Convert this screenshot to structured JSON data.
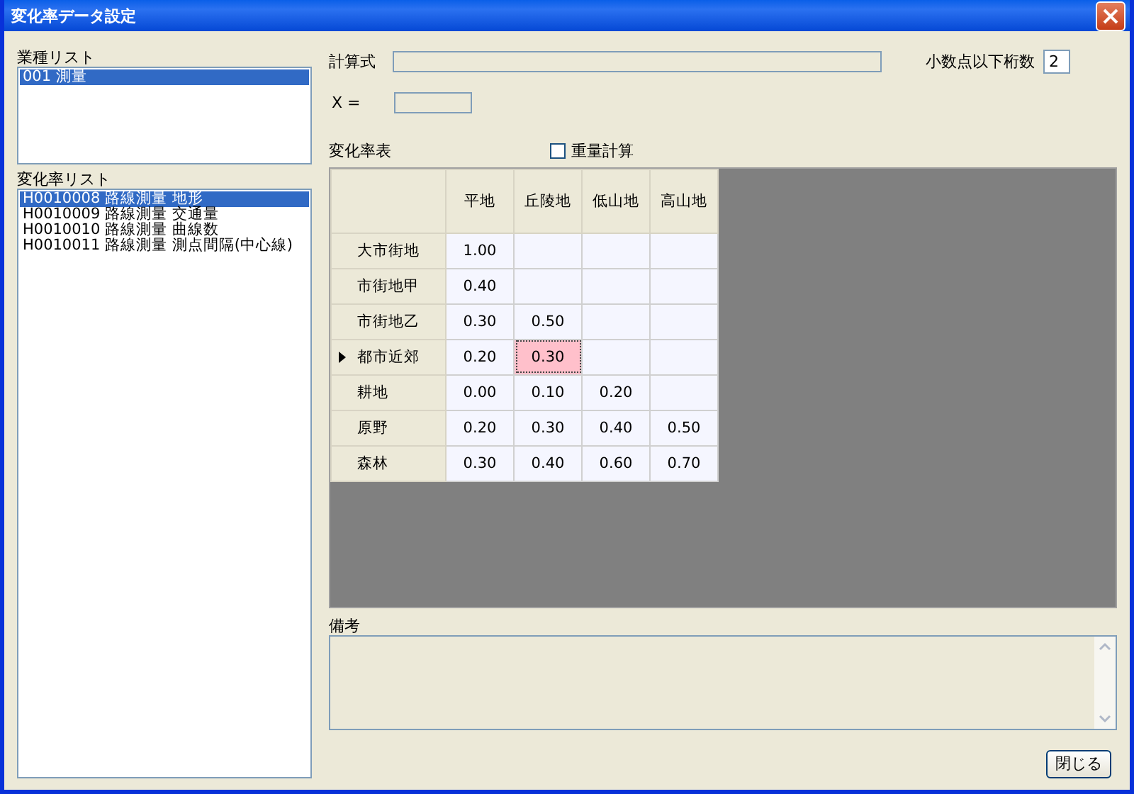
{
  "window": {
    "title": "変化率データ設定"
  },
  "industry_list": {
    "label": "業種リスト",
    "items": [
      {
        "text": "001 測量",
        "selected": true
      }
    ]
  },
  "rate_list": {
    "label": "変化率リスト",
    "items": [
      {
        "text": "H0010008 路線測量 地形",
        "selected": true
      },
      {
        "text": "H0010009 路線測量 交通量",
        "selected": false
      },
      {
        "text": "H0010010 路線測量 曲線数",
        "selected": false
      },
      {
        "text": "H0010011 路線測量 測点間隔(中心線)",
        "selected": false
      }
    ]
  },
  "formula": {
    "label": "計算式"
  },
  "decimals": {
    "label": "小数点以下桁数",
    "value": "2"
  },
  "x": {
    "label": "X ="
  },
  "rate_table": {
    "label": "変化率表",
    "weight_calc": {
      "label": "重量計算",
      "checked": false
    },
    "columns": [
      "平地",
      "丘陵地",
      "低山地",
      "高山地"
    ],
    "rows": [
      {
        "header": "大市街地",
        "current": false,
        "cells": [
          {
            "value": "1.00",
            "selected": false
          },
          null,
          null,
          null
        ]
      },
      {
        "header": "市街地甲",
        "current": false,
        "cells": [
          {
            "value": "0.40",
            "selected": false
          },
          null,
          null,
          null
        ]
      },
      {
        "header": "市街地乙",
        "current": false,
        "cells": [
          {
            "value": "0.30",
            "selected": false
          },
          {
            "value": "0.50",
            "selected": false
          },
          null,
          null
        ]
      },
      {
        "header": "都市近郊",
        "current": true,
        "cells": [
          {
            "value": "0.20",
            "selected": false
          },
          {
            "value": "0.30",
            "selected": true
          },
          null,
          null
        ]
      },
      {
        "header": "耕地",
        "current": false,
        "cells": [
          {
            "value": "0.00",
            "selected": false
          },
          {
            "value": "0.10",
            "selected": false
          },
          {
            "value": "0.20",
            "selected": false
          },
          null
        ]
      },
      {
        "header": "原野",
        "current": false,
        "cells": [
          {
            "value": "0.20",
            "selected": false
          },
          {
            "value": "0.30",
            "selected": false
          },
          {
            "value": "0.40",
            "selected": false
          },
          {
            "value": "0.50",
            "selected": false
          }
        ]
      },
      {
        "header": "森林",
        "current": false,
        "cells": [
          {
            "value": "0.30",
            "selected": false
          },
          {
            "value": "0.40",
            "selected": false
          },
          {
            "value": "0.60",
            "selected": false
          },
          {
            "value": "0.70",
            "selected": false
          }
        ]
      }
    ]
  },
  "notes": {
    "label": "備考"
  },
  "buttons": {
    "close": "閉じる"
  }
}
